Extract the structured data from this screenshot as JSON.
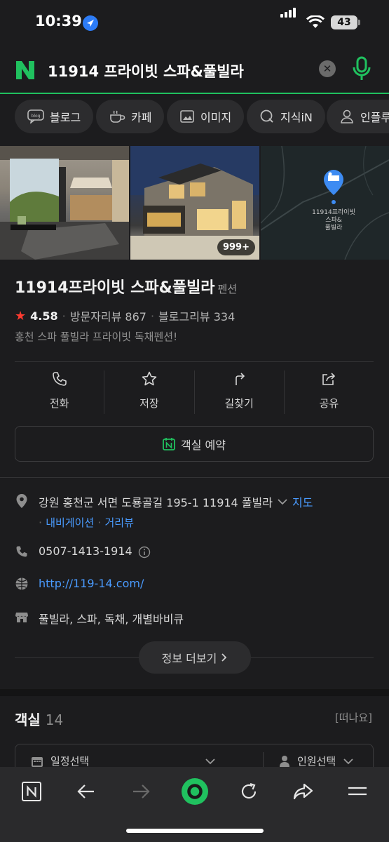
{
  "status_bar": {
    "time": "10:39",
    "battery": "43"
  },
  "search": {
    "query": "11914 프라이빗 스파&풀빌라"
  },
  "chips": [
    {
      "label": "블로그",
      "icon": "blog-icon"
    },
    {
      "label": "카페",
      "icon": "cafe-icon"
    },
    {
      "label": "이미지",
      "icon": "image-icon"
    },
    {
      "label": "지식iN",
      "icon": "knowledge-icon"
    },
    {
      "label": "인플루",
      "icon": "influencer-icon"
    }
  ],
  "gallery": {
    "photo_count": "999+",
    "map_pin_label": "11914프라이빗\n스파&\n풀빌라"
  },
  "place": {
    "name": "11914프라이빗 스파&풀빌라",
    "category": "펜션",
    "rating": "4.58",
    "visitor_reviews": "방문자리뷰 867",
    "blog_reviews": "블로그리뷰 334",
    "description": "홍천 스파 풀빌라 프라이빗 독채펜션!"
  },
  "actions": [
    {
      "label": "전화",
      "icon": "phone-icon"
    },
    {
      "label": "저장",
      "icon": "star-icon"
    },
    {
      "label": "길찾기",
      "icon": "directions-icon"
    },
    {
      "label": "공유",
      "icon": "share-icon"
    }
  ],
  "reserve_label": "객실 예약",
  "info": {
    "address": "강원 홍천군 서면 도룡골길 195-1 11914 풀빌라",
    "map_link": "지도",
    "navi_link": "내비게이션",
    "street_view_link": "거리뷰",
    "phone": "0507-1413-1914",
    "website": "http://119-14.com/",
    "tags": "풀빌라, 스파, 독채, 개별바비큐",
    "more_label": "정보 더보기"
  },
  "rooms": {
    "title": "객실",
    "count": "14",
    "cta": "[떠나요]",
    "date_label": "일정선택",
    "people_label": "인원선택"
  },
  "colors": {
    "accent_green": "#20c15f",
    "link_blue": "#4a9bff",
    "star_red": "#ff3b30",
    "background": "#1c1c1e"
  }
}
